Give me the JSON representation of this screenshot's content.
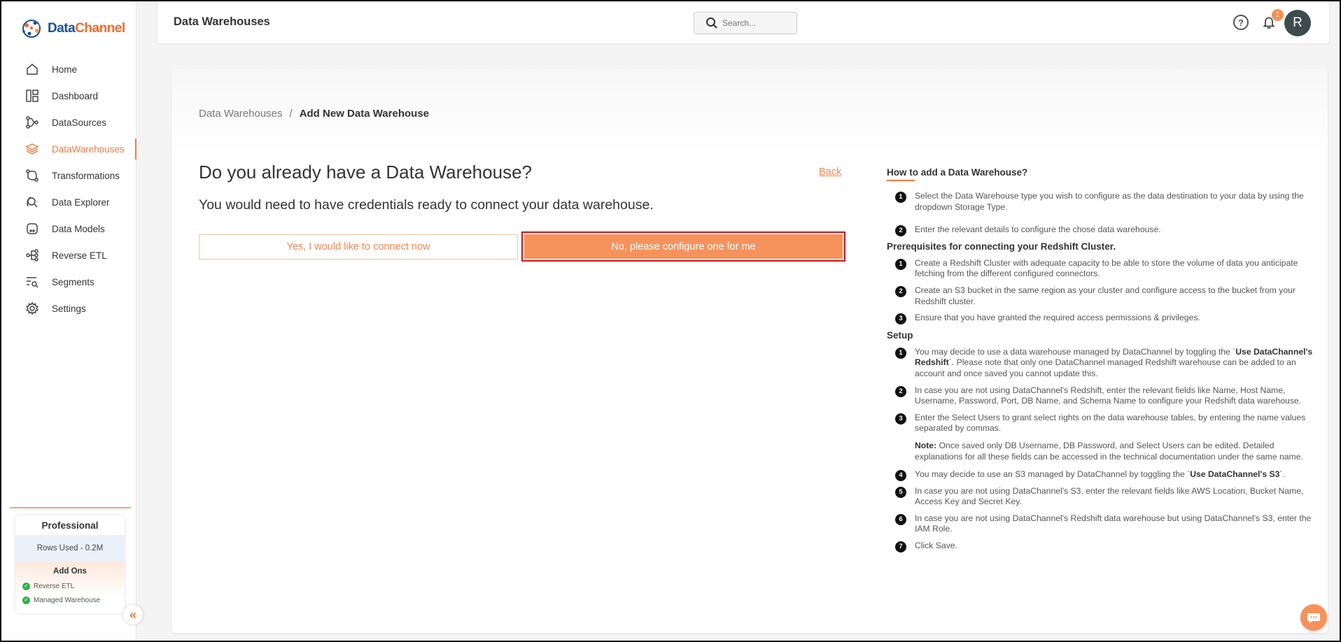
{
  "brand": {
    "part1": "Data",
    "part2": "Channel"
  },
  "sidebar": {
    "items": [
      {
        "label": "Home",
        "icon": "home-icon"
      },
      {
        "label": "Dashboard",
        "icon": "dashboard-icon"
      },
      {
        "label": "DataSources",
        "icon": "datasources-icon"
      },
      {
        "label": "DataWarehouses",
        "icon": "layers-icon",
        "active": true
      },
      {
        "label": "Transformations",
        "icon": "transformations-icon"
      },
      {
        "label": "Data Explorer",
        "icon": "explorer-icon"
      },
      {
        "label": "Data Models",
        "icon": "data-models-icon"
      },
      {
        "label": "Reverse ETL",
        "icon": "reverse-etl-icon"
      },
      {
        "label": "Segments",
        "icon": "segments-icon"
      },
      {
        "label": "Settings",
        "icon": "gear-icon"
      }
    ],
    "plan": {
      "name": "Professional",
      "rows_used": "Rows Used - 0.2M",
      "addons_title": "Add Ons",
      "addons": [
        "Reverse ETL",
        "Managed Warehouse"
      ]
    },
    "collapse_glyph": "«"
  },
  "header": {
    "title": "Data Warehouses",
    "search_placeholder": "Search...",
    "notifications_count": "1",
    "avatar_letter": "R",
    "help_glyph": "?"
  },
  "breadcrumb": {
    "parent": "Data Warehouses",
    "separator": "/",
    "current": "Add New Data Warehouse"
  },
  "main": {
    "question": "Do you already have a Data Warehouse?",
    "back_label": "Back",
    "subtitle": "You would need to have credentials ready to connect your data warehouse.",
    "yes_label": "Yes, I would like to connect now",
    "no_label": "No, please configure one for me"
  },
  "help": {
    "how_title": "How to add a Data Warehouse?",
    "how_steps": [
      "Select the Data Warehouse type you wish to configure as the data destination to your data by using the dropdown Storage Type.",
      "Enter the relevant details to configure the chose data warehouse."
    ],
    "prereq_title": "Prerequisites for connecting your Redshift Cluster.",
    "prereq_steps": [
      "Create a Redshift Cluster with adequate capacity to be able to store the volume of data you anticipate fetching from the different configured connectors.",
      "Create an S3 bucket in the same region as your cluster and configure access to the bucket from your Redshift cluster.",
      "Ensure that you have granted the required access permissions & privileges."
    ],
    "setup_title": "Setup",
    "setup1_pre": "You may decide to use a data warehouse managed by DataChannel by toggling the `",
    "setup1_bold": "Use DataChannel's Redshift",
    "setup1_post": "`. Please note that only one DataChannel managed Redshift warehouse can be added to an account and once saved you cannot update this.",
    "setup2": "In case you are not using DataChannel's Redshift, enter the relevant fields like Name, Host Name, Username, Password, Port, DB Name, and Schema Name to configure your Redshift data warehouse.",
    "setup3": "Enter the Select Users to grant select rights on the data warehouse tables, by entering the name values separated by commas.",
    "note_label": "Note:",
    "note_text": " Once saved only DB Username, DB Password, and Select Users can be edited. Detailed explanations for all these fields can be accessed in the technical documentation under the same name.",
    "setup4_pre": "You may decide to use an S3 managed by DataChannel by toggling the `",
    "setup4_bold": "Use DataChannel's S3",
    "setup4_post": "`.",
    "setup5": "In case you are not using DataChannel's S3, enter the relevant fields like AWS Location, Bucket Name, Access Key and Secret Key.",
    "setup6": "In case you are not using DataChannel's Redshift data warehouse but using DataChannel's S3, enter the IAM Role.",
    "setup7": "Click Save.",
    "nums": [
      "1",
      "2",
      "3",
      "4",
      "5",
      "6",
      "7"
    ]
  },
  "colors": {
    "accent": "#f47a3d",
    "button_fill": "#f6925b",
    "selection_outline": "#c0161c"
  }
}
